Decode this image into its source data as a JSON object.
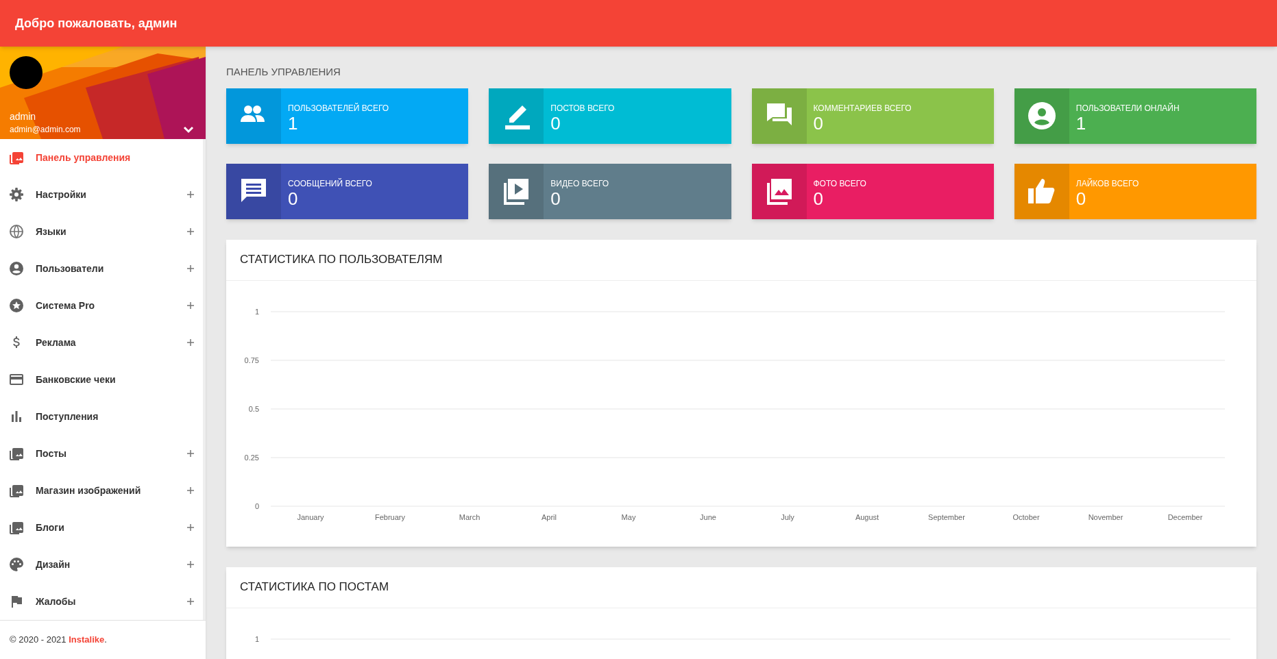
{
  "header": {
    "title": "Добро пожаловать, админ"
  },
  "profile": {
    "name": "admin",
    "email": "admin@admin.com"
  },
  "sidebar": {
    "items": [
      {
        "label": "Панель управления",
        "selected": true,
        "expandable": false
      },
      {
        "label": "Настройки",
        "selected": false,
        "expandable": true
      },
      {
        "label": "Языки",
        "selected": false,
        "expandable": true
      },
      {
        "label": "Пользователи",
        "selected": false,
        "expandable": true
      },
      {
        "label": "Система Pro",
        "selected": false,
        "expandable": true
      },
      {
        "label": "Реклама",
        "selected": false,
        "expandable": true
      },
      {
        "label": "Банковские чеки",
        "selected": false,
        "expandable": false
      },
      {
        "label": "Поступления",
        "selected": false,
        "expandable": false
      },
      {
        "label": "Посты",
        "selected": false,
        "expandable": true
      },
      {
        "label": "Магазин изображений",
        "selected": false,
        "expandable": true
      },
      {
        "label": "Блоги",
        "selected": false,
        "expandable": true
      },
      {
        "label": "Дизайн",
        "selected": false,
        "expandable": true
      },
      {
        "label": "Жалобы",
        "selected": false,
        "expandable": true
      }
    ]
  },
  "footer": {
    "copyright": "© 2020 - 2021",
    "brand": "Instalike",
    "suffix": "."
  },
  "page_title": "ПАНЕЛЬ УПРАВЛЕНИЯ",
  "stats": [
    {
      "label": "ПОЛЬЗОВАТЕЛЕЙ ВСЕГО",
      "value": "1",
      "color": "#03a9f4"
    },
    {
      "label": "ПОСТОВ ВСЕГО",
      "value": "0",
      "color": "#00bcd4"
    },
    {
      "label": "КОММЕНТАРИЕВ ВСЕГО",
      "value": "0",
      "color": "#8bc34a"
    },
    {
      "label": "ПОЛЬЗОВАТЕЛИ ОНЛАЙН",
      "value": "1",
      "color": "#4caf50"
    },
    {
      "label": "СООБЩЕНИЙ ВСЕГО",
      "value": "0",
      "color": "#3f51b5"
    },
    {
      "label": "ВИДЕО ВСЕГО",
      "value": "0",
      "color": "#607d8b"
    },
    {
      "label": "ФОТО ВСЕГО",
      "value": "0",
      "color": "#e91e63"
    },
    {
      "label": "ЛАЙКОВ ВСЕГО",
      "value": "0",
      "color": "#ff9800"
    }
  ],
  "charts": [
    {
      "title": "СТАТИСТИКА ПО ПОЛЬЗОВАТЕЛЯМ",
      "chart_data": {
        "type": "line",
        "grid": true,
        "categories": [
          "January",
          "February",
          "March",
          "April",
          "May",
          "June",
          "July",
          "August",
          "September",
          "October",
          "November",
          "December"
        ],
        "ylim": [
          0,
          1
        ],
        "yticks": [
          0,
          0.25,
          0.5,
          0.75,
          1
        ]
      }
    },
    {
      "title": "СТАТИСТИКА ПО ПОСТАМ",
      "axis_label": "1"
    }
  ]
}
